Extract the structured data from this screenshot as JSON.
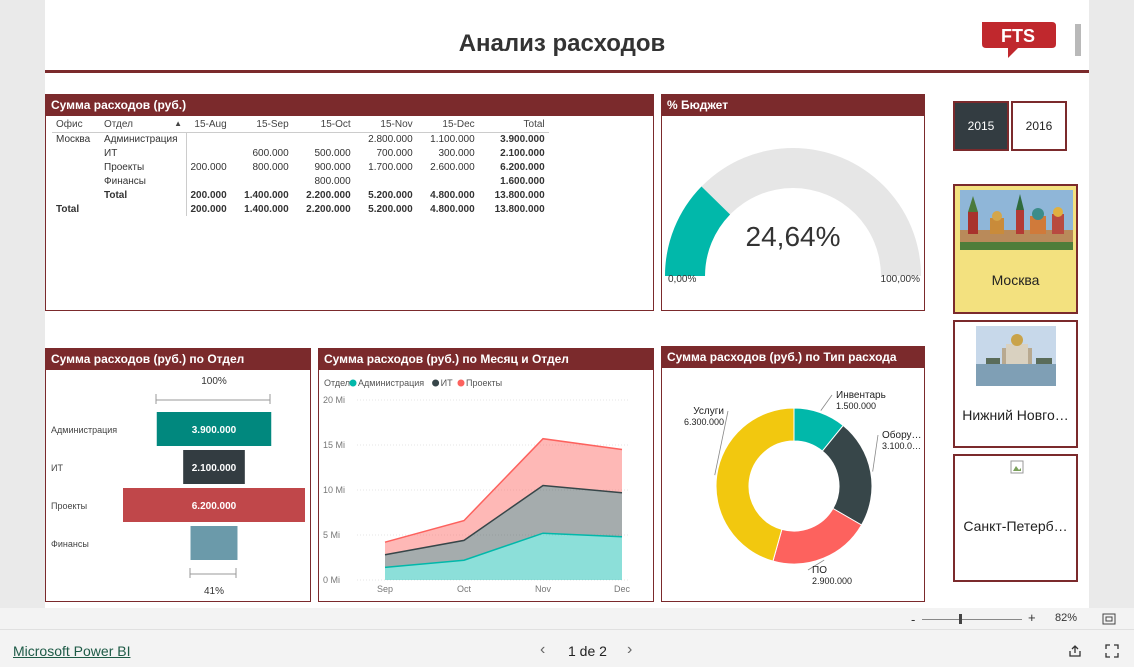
{
  "header": {
    "title": "Анализ расходов",
    "logo_text": "FTS"
  },
  "matrix": {
    "title": "Сумма расходов (руб.)",
    "columns": [
      "Офис",
      "Отдел",
      "15-Aug",
      "15-Sep",
      "15-Oct",
      "15-Nov",
      "15-Dec",
      "Total"
    ],
    "rows": [
      [
        "Москва",
        "Администрация",
        "",
        "",
        "",
        "2.800.000",
        "1.100.000",
        "3.900.000"
      ],
      [
        "",
        "ИТ",
        "",
        "600.000",
        "500.000",
        "700.000",
        "300.000",
        "2.100.000"
      ],
      [
        "",
        "Проекты",
        "200.000",
        "800.000",
        "900.000",
        "1.700.000",
        "2.600.000",
        "6.200.000"
      ],
      [
        "",
        "Финансы",
        "",
        "",
        "800.000",
        "",
        "",
        "1.600.000"
      ]
    ],
    "subtotal": [
      "",
      "Total",
      "200.000",
      "1.400.000",
      "2.200.000",
      "5.200.000",
      "4.800.000",
      "13.800.000"
    ],
    "total": [
      "Total",
      "",
      "200.000",
      "1.400.000",
      "2.200.000",
      "5.200.000",
      "4.800.000",
      "13.800.000"
    ]
  },
  "gauge": {
    "title": "% Бюджет",
    "value_label": "24,64%",
    "value": 24.64,
    "min_label": "0,00%",
    "max_label": "100,00%",
    "fill_color": "#01b8aa",
    "track_color": "#e6e6e6"
  },
  "year_slicer": {
    "options": [
      "2015",
      "2016"
    ],
    "selected": "2015"
  },
  "offices": [
    {
      "name": "Москва",
      "selected": true
    },
    {
      "name": "Нижний Новго…",
      "selected": false
    },
    {
      "name": "Санкт-Петерб…",
      "selected": false
    }
  ],
  "funnel": {
    "title": "Сумма расходов (руб.) по Отдел",
    "top_pct": "100%",
    "bottom_pct": "41%",
    "chart_data": {
      "type": "bar",
      "categories": [
        "Администрация",
        "ИТ",
        "Проекты",
        "Финансы"
      ],
      "values": [
        3900000,
        2100000,
        6200000,
        1600000
      ],
      "value_labels": [
        "3.900.000",
        "2.100.000",
        "6.200.000",
        ""
      ],
      "colors": [
        "#01887e",
        "#333c41",
        "#c0474a",
        "#6b9aaa"
      ]
    }
  },
  "area": {
    "title": "Сумма расходов (руб.) по Месяц и Отдел",
    "legend_title": "Отдел",
    "chart_data": {
      "type": "area",
      "x": [
        "Sep",
        "Oct",
        "Nov",
        "Dec"
      ],
      "yticks": [
        "0 Mi",
        "5 Mi",
        "10 Mi",
        "15 Mi",
        "20 Mi"
      ],
      "ylim": [
        0,
        20
      ],
      "series": [
        {
          "name": "Администрация",
          "color": "#01b8aa",
          "values": [
            1.4,
            2.2,
            5.2,
            4.8
          ]
        },
        {
          "name": "ИТ",
          "color": "#374649",
          "values": [
            1.4,
            2.2,
            5.2,
            4.8
          ]
        },
        {
          "name": "Проекты",
          "color": "#fd625e",
          "values": [
            1.4,
            2.0,
            5.3,
            4.8
          ]
        }
      ],
      "stack_tops": [
        4.2,
        6.6,
        15.7,
        14.5
      ],
      "mid_tops": [
        2.8,
        4.4,
        10.5,
        9.7
      ],
      "low_tops": [
        1.4,
        2.2,
        5.2,
        4.8
      ]
    }
  },
  "donut": {
    "title": "Сумма расходов (руб.) по Тип расхода",
    "chart_data": {
      "type": "pie",
      "labels": [
        "Инвентарь",
        "Обору…",
        "ПО",
        "Услуги"
      ],
      "values": [
        1500000,
        3100000,
        2900000,
        6300000
      ],
      "value_labels": [
        "1.500.000",
        "3.100.0…",
        "2.900.000",
        "6.300.000"
      ],
      "colors": [
        "#01b8aa",
        "#374649",
        "#fd625e",
        "#f2c80f"
      ]
    }
  },
  "footer": {
    "zoom": "82%",
    "zoom_minus": "-",
    "zoom_plus": "+",
    "brand_link": "Microsoft Power BI",
    "page_label": "1 de 2"
  }
}
